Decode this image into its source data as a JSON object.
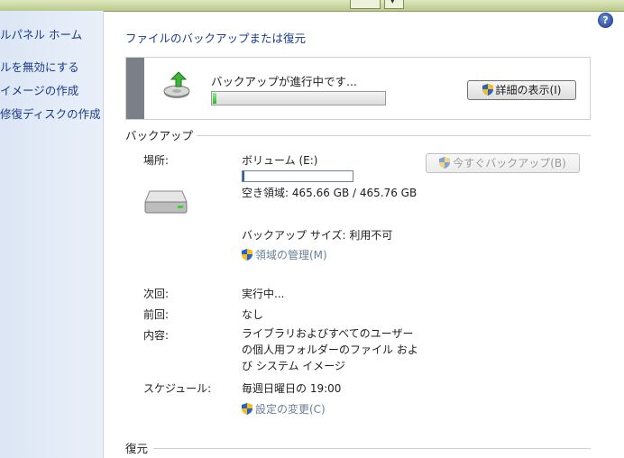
{
  "nav": {
    "home": "ルパネル ホーム",
    "links": [
      "ルを無効にする",
      "イメージの作成",
      "修復ディスクの作成"
    ]
  },
  "help_label": "?",
  "page_title": "ファイルのバックアップまたは復元",
  "progress_panel": {
    "message": "バックアップが進行中です...",
    "progress_fraction": 0.02,
    "details_button": "詳細の表示(I)"
  },
  "backup": {
    "header": "バックアップ",
    "location_label": "場所:",
    "location_value": "ボリューム (E:)",
    "capacity_used_fraction": 0.02,
    "free_space": "空き領域: 465.66 GB / 465.76 GB",
    "backup_size": "バックアップ サイズ: 利用不可",
    "manage_space_link": "領域の管理(M)",
    "backup_now_button": "今すぐバックアップ(B)",
    "next_label": "次回:",
    "next_value": "実行中...",
    "last_label": "前回:",
    "last_value": "なし",
    "contents_label": "内容:",
    "contents_value": "ライブラリおよびすべてのユーザーの個人用フォルダーのファイル および システム イメージ",
    "schedule_label": "スケジュール:",
    "schedule_value": "毎週日曜日の 19:00",
    "change_settings_link": "設定の変更(C)"
  },
  "restore": {
    "header": "復元"
  },
  "colors": {
    "link": "#1a3a8c",
    "disabled_link": "#6b7f95",
    "progress_green": "#2cb52c",
    "panel_bar": "#7a7f88"
  }
}
